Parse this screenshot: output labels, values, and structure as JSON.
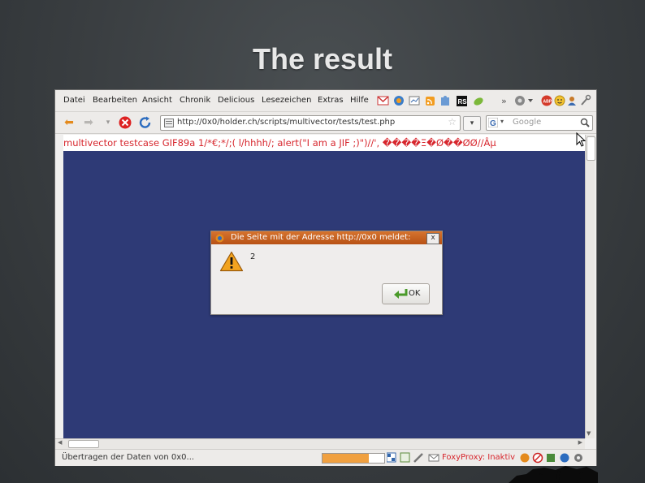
{
  "slide": {
    "title": "The result"
  },
  "menubar": {
    "items": [
      "Datei",
      "Bearbeiten",
      "Ansicht",
      "Chronik",
      "Delicious",
      "Lesezeichen",
      "Extras",
      "Hilfe"
    ],
    "rs_label": "RS",
    "overflow": "»"
  },
  "navbar": {
    "url": "http://0x0/holder.ch/scripts/multivector/tests/test.php",
    "search_placeholder": "Google"
  },
  "page": {
    "text": "multivector testcase GIF89a 1/*€;*/;( l/hhhh/; alert(\"I am a JIF ;)\")//', ����Ξ�Ø��ØØ//Âμ"
  },
  "dialog": {
    "title": "Die Seite mit der Adresse http://0x0 meldet:",
    "message": "2",
    "ok_label": "OK",
    "close_glyph": "x"
  },
  "statusbar": {
    "text": "Übertragen der Daten von 0x0...",
    "progress": 0.75,
    "foxyproxy": "FoxyProxy: Inaktiv"
  },
  "colors": {
    "accent_red": "#d7262d",
    "page_bg": "#2e3a76",
    "dialog_title": "#c2601f"
  }
}
